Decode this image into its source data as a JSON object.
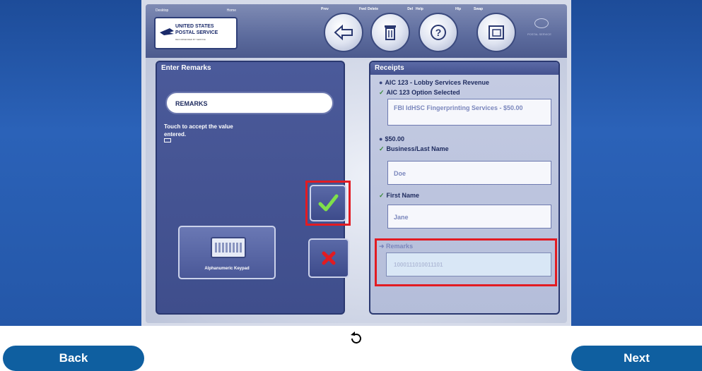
{
  "header": {
    "logo": {
      "top_left": "Desktop",
      "top_right": "Home",
      "line1": "UNITED STATES",
      "line2": "POSTAL SERVICE",
      "line3": "RECOMMENDED BY SERVICE"
    },
    "tabs": [
      {
        "left": "Prev",
        "right": "Fwd",
        "icon": "back-arrow-icon"
      },
      {
        "left": "Delete",
        "right": "Del",
        "icon": "trash-icon"
      },
      {
        "left": "Help",
        "right": "Hlp",
        "icon": "question-icon"
      },
      {
        "left": "Swap",
        "right": "",
        "icon": "window-icon"
      }
    ],
    "globe_text": "POSTAL SERVICE"
  },
  "left_panel": {
    "title": "Enter Remarks",
    "field_value": "REMARKS",
    "hint": "Touch to accept the value entered.",
    "keypad_label": "Alphanumeric Keypad"
  },
  "receipts": {
    "title": "Receipts",
    "line1": "AIC 123 - Lobby Services Revenue",
    "line2": "AIC 123 Option Selected",
    "option_value": "FBI IdHSC Fingerprinting Services - $50.00",
    "amount": "$50.00",
    "lastname_label": "Business/Last Name",
    "lastname_value": "Doe",
    "firstname_label": "First Name",
    "firstname_value": "Jane",
    "remarks_label": "Remarks",
    "remarks_value": "1000111010011101"
  },
  "nav": {
    "back": "Back",
    "next": "Next"
  },
  "colors": {
    "side_blue": "#2457a8",
    "panel_navy": "#3f4e8c",
    "highlight_red": "#e21b22",
    "check_green": "#3a8a3a",
    "pill_blue": "#0f5fa0"
  }
}
